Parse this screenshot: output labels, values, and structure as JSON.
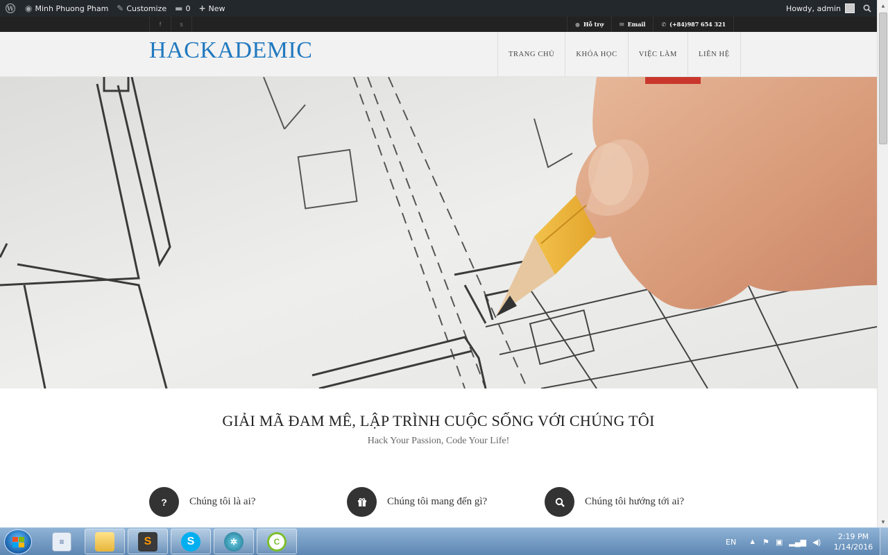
{
  "adminbar": {
    "site_name": "Minh Phuong Pham",
    "customize": "Customize",
    "comments_count": "0",
    "new_label": "New",
    "howdy": "Howdy, admin"
  },
  "topbar": {
    "social": [
      "f",
      "s"
    ],
    "support": "Hỗ trợ",
    "email": "Email",
    "phone": "(+84)987 654 321"
  },
  "header": {
    "logo": "HACKADEMIC",
    "nav": [
      "TRANG CHỦ",
      "KHÓA HỌC",
      "VIỆC LÀM",
      "LIÊN HỆ"
    ]
  },
  "intro": {
    "title": "GIẢI MÃ ĐAM MÊ, LẬP TRÌNH CUỘC SỐNG VỚI CHÚNG TÔI",
    "subtitle": "Hack Your Passion, Code Your Life!"
  },
  "features": [
    {
      "label": "Chúng tôi là ai?",
      "icon": "?"
    },
    {
      "label": "Chúng tôi mang đến gì?",
      "icon": "🎁"
    },
    {
      "label": "Chúng tôi hướng tới ai?",
      "icon": "🔍"
    }
  ],
  "taskbar": {
    "language": "EN",
    "time": "2:19 PM",
    "date": "1/14/2016"
  },
  "colors": {
    "logo": "#2179bf",
    "adminbar": "#23282d",
    "topstrip": "#222222",
    "header_bg": "#f2f2f2"
  }
}
